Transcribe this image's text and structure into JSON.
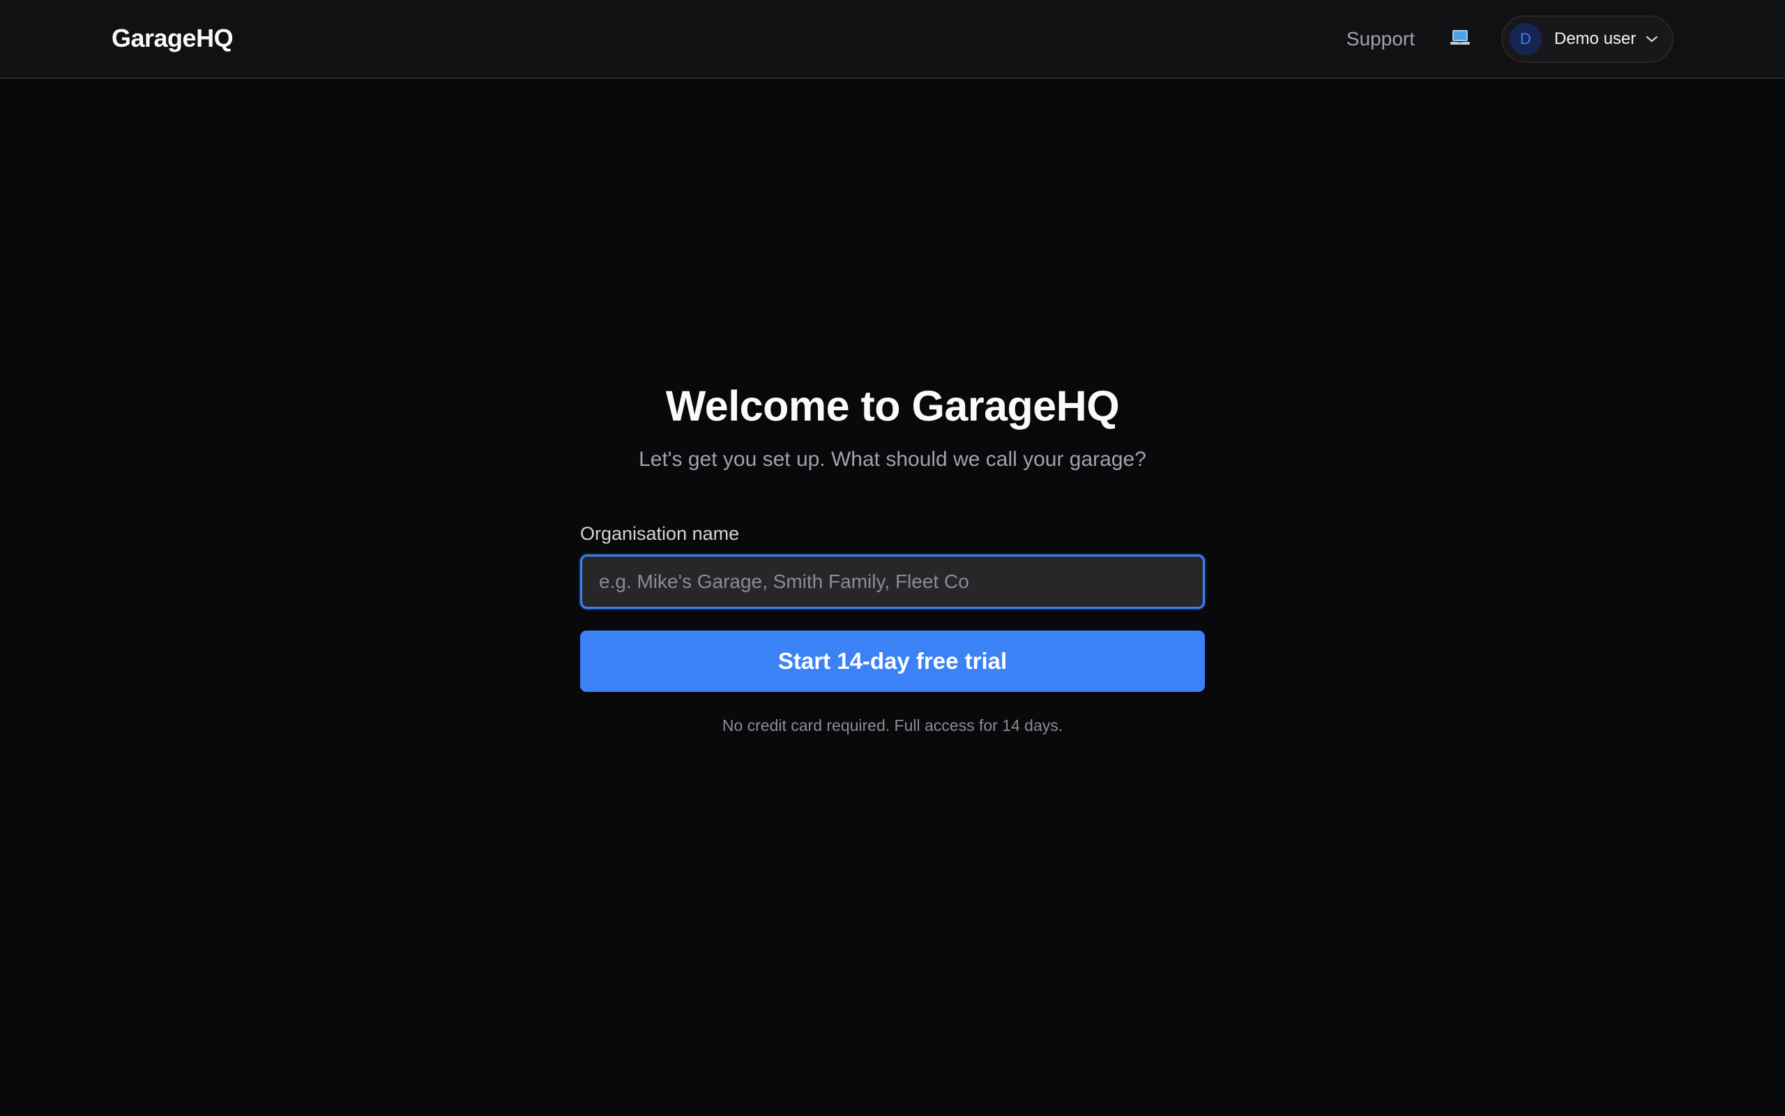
{
  "header": {
    "brand": "GarageHQ",
    "support_label": "Support",
    "theme_icon": "laptop-icon",
    "user": {
      "initial": "D",
      "name": "Demo user",
      "menu_icon": "chevron-down-icon"
    }
  },
  "onboarding": {
    "title": "Welcome to GarageHQ",
    "subtitle": "Let's get you set up. What should we call your garage?",
    "org_label": "Organisation name",
    "org_placeholder": "e.g. Mike's Garage, Smith Family, Fleet Co",
    "org_value": "",
    "cta_label": "Start 14-day free trial",
    "footnote": "No credit card required. Full access for 14 days."
  },
  "colors": {
    "background": "#09090b",
    "header_bg": "#111114",
    "accent": "#3b82f6",
    "muted_text": "#a1a1aa"
  }
}
